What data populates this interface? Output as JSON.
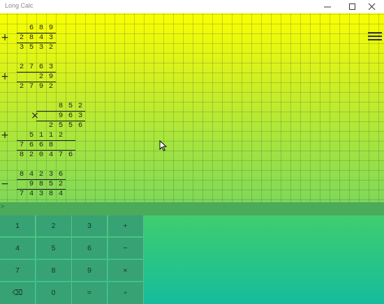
{
  "window": {
    "title": "Long Calc"
  },
  "calculations": [
    {
      "op": "+",
      "rows": [
        {
          "digits": [
            "",
            "",
            "6",
            "8",
            "9"
          ]
        },
        {
          "digits": [
            "",
            "2",
            "8",
            "4",
            "3"
          ]
        },
        {
          "digits": [
            "",
            "3",
            "5",
            "3",
            "2"
          ]
        }
      ]
    },
    {
      "op": "+",
      "rows": [
        {
          "digits": [
            "",
            "2",
            "7",
            "6",
            "3"
          ]
        },
        {
          "digits": [
            "",
            "",
            "",
            "2",
            "9"
          ]
        },
        {
          "digits": [
            "",
            "2",
            "7",
            "9",
            "2"
          ]
        }
      ]
    },
    {
      "op": "×",
      "rows": [
        {
          "digits": [
            "",
            "",
            "",
            "8",
            "5",
            "2"
          ]
        },
        {
          "digits": [
            "",
            "",
            "",
            "9",
            "6",
            "3"
          ]
        },
        {
          "digits": [
            "",
            "",
            "2",
            "5",
            "5",
            "6"
          ]
        }
      ]
    },
    {
      "op": "+",
      "rows": [
        {
          "digits": [
            "",
            "",
            "5",
            "1",
            "1",
            "2",
            ""
          ]
        },
        {
          "digits": [
            "",
            "7",
            "6",
            "6",
            "8",
            "",
            ""
          ]
        },
        {
          "digits": [
            "",
            "8",
            "2",
            "0",
            "4",
            "7",
            "6"
          ]
        }
      ]
    },
    {
      "op": "−",
      "rows": [
        {
          "digits": [
            "",
            "8",
            "4",
            "2",
            "3",
            "6"
          ]
        },
        {
          "digits": [
            "",
            "",
            "9",
            "8",
            "5",
            "2"
          ]
        },
        {
          "digits": [
            "",
            "7",
            "4",
            "3",
            "8",
            "4"
          ]
        }
      ]
    }
  ],
  "input": {
    "prompt": ">"
  },
  "keypad": [
    [
      "1",
      "2",
      "3",
      "+"
    ],
    [
      "4",
      "5",
      "6",
      "−"
    ],
    [
      "7",
      "8",
      "9",
      "×"
    ],
    [
      "⌫",
      "0",
      "=",
      "÷"
    ]
  ]
}
